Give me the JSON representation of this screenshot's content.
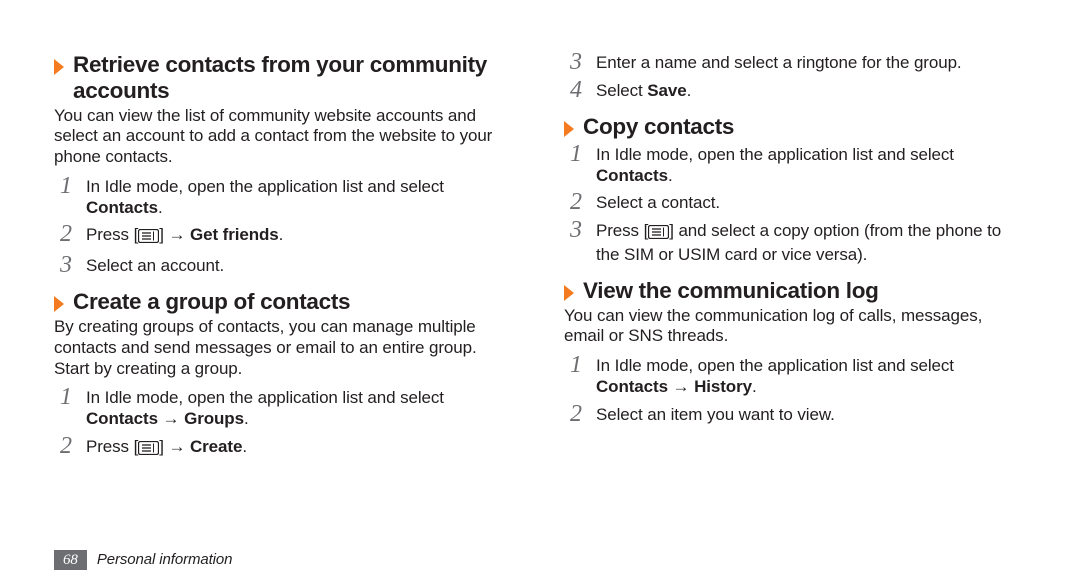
{
  "left": {
    "s1": {
      "title": "Retrieve contacts from your community accounts",
      "intro": "You can view the list of community website accounts and select an account to add a contact from the website to your phone contacts.",
      "st1a": "In Idle mode, open the application list and select ",
      "st1b": "Contacts",
      "st1c": ".",
      "st2a": "Press [",
      "st2b": "] → ",
      "st2c": "Get friends",
      "st2d": ".",
      "st3": "Select an account."
    },
    "s2": {
      "title": "Create a group of contacts",
      "intro": "By creating groups of contacts, you can manage multiple contacts and send messages or email to an entire group. Start by creating a group.",
      "st1a": "In Idle mode, open the application list and select ",
      "st1b": "Contacts",
      "st1c": " → ",
      "st1d": "Groups",
      "st1e": ".",
      "st2a": "Press [",
      "st2b": "] → ",
      "st2c": "Create",
      "st2d": "."
    }
  },
  "right": {
    "top": {
      "st3": "Enter a name and select a ringtone for the group.",
      "st4a": "Select ",
      "st4b": "Save",
      "st4c": "."
    },
    "s3": {
      "title": "Copy contacts",
      "st1a": "In Idle mode, open the application list and select ",
      "st1b": "Contacts",
      "st1c": ".",
      "st2": "Select a contact.",
      "st3a": "Press [",
      "st3b": "] and select a copy option (from the phone to the SIM or USIM card or vice versa)."
    },
    "s4": {
      "title": "View the communication log",
      "intro": "You can view the communication log of calls, messages, email or SNS threads.",
      "st1a": "In Idle mode, open the application list and select ",
      "st1b": "Contacts",
      "st1c": " → ",
      "st1d": "History",
      "st1e": ".",
      "st2": "Select an item you want to view."
    }
  },
  "nums": {
    "n1": "1",
    "n2": "2",
    "n3": "3",
    "n4": "4"
  },
  "footer": {
    "page": "68",
    "section": "Personal information"
  }
}
